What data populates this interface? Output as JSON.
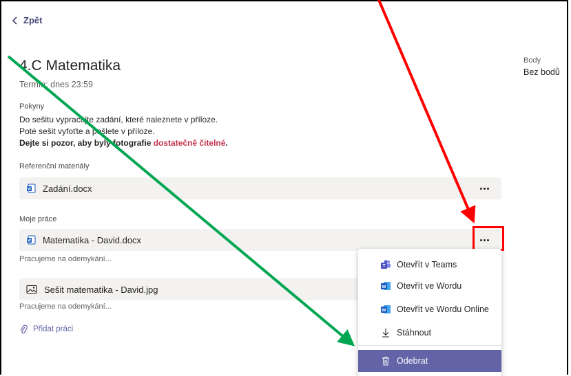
{
  "nav": {
    "back_label": "Zpět"
  },
  "assignment": {
    "title": "4.C Matematika",
    "due": "Termín: dnes 23:59",
    "instructions_label": "Pokyny",
    "instructions_line1": "Do sešitu vypracujte zadání, které naleznete v příloze.",
    "instructions_line2": "Poté sešit vyfoťte a pošlete v příloze.",
    "instructions_line3_bold": "Dejte si pozor, aby byly fotografie ",
    "instructions_line3_red": "dostatečně čitelné",
    "instructions_line3_end": "."
  },
  "points": {
    "label": "Body",
    "value": "Bez bodů"
  },
  "reference": {
    "label": "Referenční materiály",
    "file_name": "Zadání.docx"
  },
  "my_work": {
    "label": "Moje práce",
    "files": [
      {
        "name": "Matematika - David.docx",
        "status": "Pracujeme na odemykání..."
      },
      {
        "name": "Sešit matematika - David.jpg",
        "status": "Pracujeme na odemykání..."
      }
    ],
    "add_label": "Přidat práci"
  },
  "context_menu": {
    "items": [
      {
        "label": "Otevřít v Teams",
        "icon": "teams-icon"
      },
      {
        "label": "Otevřít ve Wordu",
        "icon": "word-icon"
      },
      {
        "label": "Otevřít ve Wordu Online",
        "icon": "word-icon"
      },
      {
        "label": "Stáhnout",
        "icon": "download-icon"
      },
      {
        "label": "Odebrat",
        "icon": "trash-icon"
      }
    ]
  },
  "colors": {
    "accent": "#6264a7",
    "card_bg": "#f3f2f1",
    "highlight_box": "#ff0000",
    "annotation_red_arrow": "#ff0000",
    "annotation_green_arrow": "#00a651",
    "word_blue": "#185abd",
    "warning_text": "#c4314b"
  }
}
